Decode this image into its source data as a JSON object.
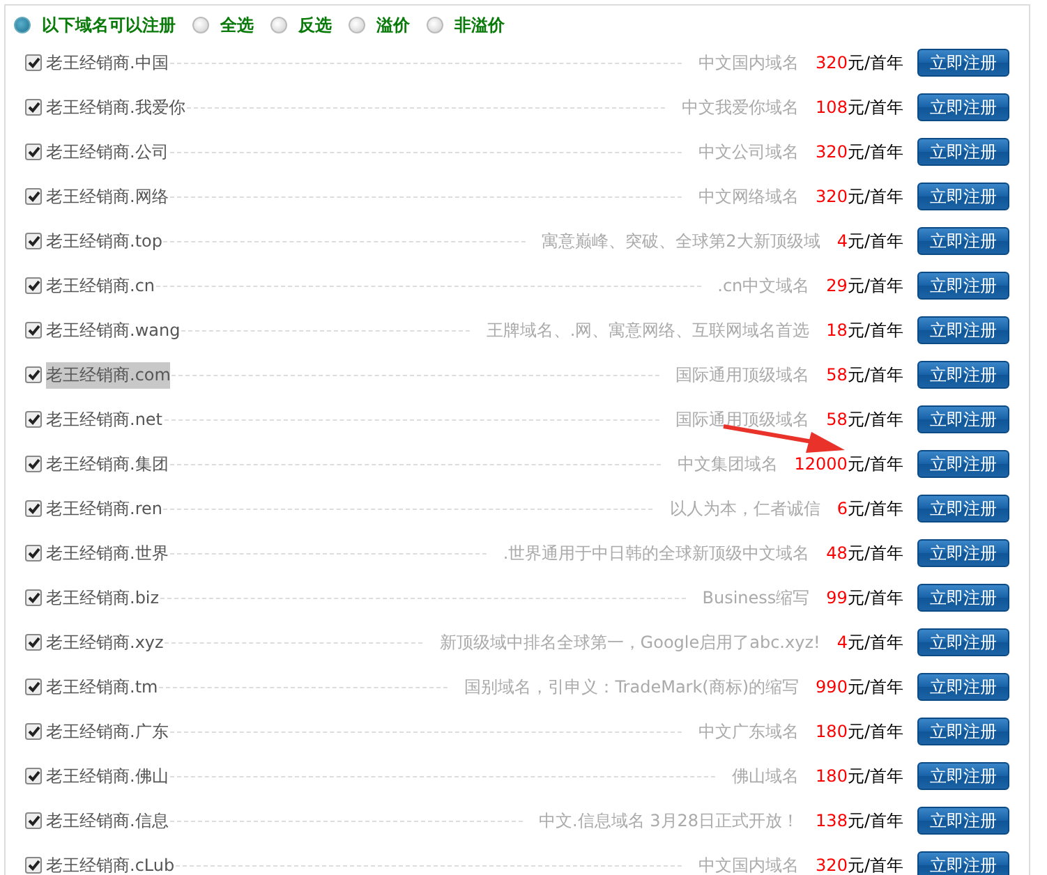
{
  "filter_options": [
    {
      "label": "以下域名可以注册",
      "selected": true
    },
    {
      "label": "全选",
      "selected": false
    },
    {
      "label": "反选",
      "selected": false
    },
    {
      "label": "溢价",
      "selected": false
    },
    {
      "label": "非溢价",
      "selected": false
    }
  ],
  "domains": [
    {
      "name": "老王经销商.中国",
      "checked": true,
      "highlighted": false,
      "description": "中文国内域名",
      "price": "320",
      "unit": "元/首年",
      "button": "立即注册"
    },
    {
      "name": "老王经销商.我爱你",
      "checked": true,
      "highlighted": false,
      "description": "中文我爱你域名",
      "price": "108",
      "unit": "元/首年",
      "button": "立即注册"
    },
    {
      "name": "老王经销商.公司",
      "checked": true,
      "highlighted": false,
      "description": "中文公司域名",
      "price": "320",
      "unit": "元/首年",
      "button": "立即注册"
    },
    {
      "name": "老王经销商.网络",
      "checked": true,
      "highlighted": false,
      "description": "中文网络域名",
      "price": "320",
      "unit": "元/首年",
      "button": "立即注册"
    },
    {
      "name": "老王经销商.top",
      "checked": true,
      "highlighted": false,
      "description": "寓意巅峰、突破、全球第2大新顶级域",
      "price": "4",
      "unit": "元/首年",
      "button": "立即注册"
    },
    {
      "name": "老王经销商.cn",
      "checked": true,
      "highlighted": false,
      "description": ".cn中文域名",
      "price": "29",
      "unit": "元/首年",
      "button": "立即注册"
    },
    {
      "name": "老王经销商.wang",
      "checked": true,
      "highlighted": false,
      "description": "王牌域名、.网、寓意网络、互联网域名首选",
      "price": "18",
      "unit": "元/首年",
      "button": "立即注册"
    },
    {
      "name": "老王经销商.com",
      "checked": true,
      "highlighted": true,
      "description": "国际通用顶级域名",
      "price": "58",
      "unit": "元/首年",
      "button": "立即注册"
    },
    {
      "name": "老王经销商.net",
      "checked": true,
      "highlighted": false,
      "description": "国际通用顶级域名",
      "price": "58",
      "unit": "元/首年",
      "button": "立即注册"
    },
    {
      "name": "老王经销商.集团",
      "checked": true,
      "highlighted": false,
      "description": "中文集团域名",
      "price": "12000",
      "unit": "元/首年",
      "button": "立即注册"
    },
    {
      "name": "老王经销商.ren",
      "checked": true,
      "highlighted": false,
      "description": "以人为本，仁者诚信",
      "price": "6",
      "unit": "元/首年",
      "button": "立即注册"
    },
    {
      "name": "老王经销商.世界",
      "checked": true,
      "highlighted": false,
      "description": ".世界通用于中日韩的全球新顶级中文域名",
      "price": "48",
      "unit": "元/首年",
      "button": "立即注册"
    },
    {
      "name": "老王经销商.biz",
      "checked": true,
      "highlighted": false,
      "description": "Business缩写",
      "price": "99",
      "unit": "元/首年",
      "button": "立即注册"
    },
    {
      "name": "老王经销商.xyz",
      "checked": true,
      "highlighted": false,
      "description": "新顶级域中排名全球第一，Google启用了abc.xyz!",
      "price": "4",
      "unit": "元/首年",
      "button": "立即注册"
    },
    {
      "name": "老王经销商.tm",
      "checked": true,
      "highlighted": false,
      "description": "国别域名，引申义：TradeMark(商标)的缩写",
      "price": "990",
      "unit": "元/首年",
      "button": "立即注册"
    },
    {
      "name": "老王经销商.广东",
      "checked": true,
      "highlighted": false,
      "description": "中文广东域名",
      "price": "180",
      "unit": "元/首年",
      "button": "立即注册"
    },
    {
      "name": "老王经销商.佛山",
      "checked": true,
      "highlighted": false,
      "description": "佛山域名",
      "price": "180",
      "unit": "元/首年",
      "button": "立即注册"
    },
    {
      "name": "老王经销商.信息",
      "checked": true,
      "highlighted": false,
      "description": "中文.信息域名 3月28日正式开放！",
      "price": "138",
      "unit": "元/首年",
      "button": "立即注册"
    },
    {
      "name": "老王经销商.cLub",
      "checked": true,
      "highlighted": false,
      "description": "中文国内域名",
      "price": "320",
      "unit": "元/首年",
      "button": "立即注册"
    }
  ]
}
